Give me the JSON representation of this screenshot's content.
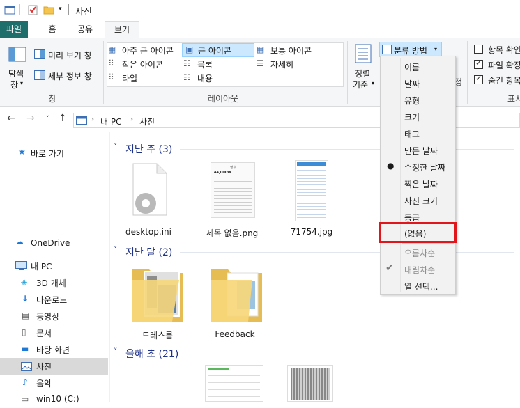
{
  "window": {
    "title": "사진"
  },
  "ribbon_tabs": [
    {
      "label": "파일"
    },
    {
      "label": "홈"
    },
    {
      "label": "공유"
    },
    {
      "label": "보기"
    }
  ],
  "panes": {
    "navigation_pane": "탐색",
    "navigation_pane2": "창",
    "preview_pane": "미리 보기 창",
    "details_pane": "세부 정보 창",
    "group_label": "창"
  },
  "layout": {
    "options": [
      "아주 큰 아이콘",
      "큰 아이콘",
      "보통 아이콘",
      "작은 아이콘",
      "목록",
      "자세히",
      "타일",
      "내용"
    ],
    "selected": "큰 아이콘",
    "group_label": "레이아웃"
  },
  "current_view": {
    "sort_by": "정렬",
    "sort_by2": "기준",
    "group_by": "분류 방법",
    "partial_label": "정"
  },
  "show_hide": {
    "item_checkbox": "항목 확인",
    "extensions": "파일 확장",
    "hidden_items": "숨긴 항목",
    "group_label_partial": "표시"
  },
  "address": {
    "parts": [
      "내 PC",
      "사진"
    ]
  },
  "sidebar": {
    "quick_access": "바로 가기",
    "onedrive": "OneDrive",
    "this_pc": "내 PC",
    "items": [
      "3D 개체",
      "다운로드",
      "동영상",
      "문서",
      "바탕 화면",
      "사진",
      "음악",
      "win10 (C:)"
    ],
    "selected": "사진"
  },
  "groups": [
    {
      "header": "지난 주 (3)",
      "files": [
        "desktop.ini",
        "제목 없음.png",
        "71754.jpg"
      ]
    },
    {
      "header": "지난 달 (2)",
      "files": [
        "드레스룸",
        "Feedback"
      ]
    },
    {
      "header": "올해 초 (21)",
      "files": []
    }
  ],
  "receipt_thumb": {
    "title": "영수",
    "amount": "44,000₩"
  },
  "group_by_menu": {
    "items": [
      "이름",
      "날짜",
      "유형",
      "크기",
      "태그",
      "만든 날짜",
      "수정한 날짜",
      "찍은 날짜",
      "사진 크기",
      "등급",
      "(없음)",
      "오름차순",
      "내림차순",
      "열 선택..."
    ],
    "selected_bullet": "수정한 날짜",
    "checked": "내림차순",
    "highlighted": "(없음)"
  },
  "colors": {
    "file_tab": "#1e6e6c",
    "highlight_border": "#e0161c",
    "group_header": "#1e3287"
  }
}
